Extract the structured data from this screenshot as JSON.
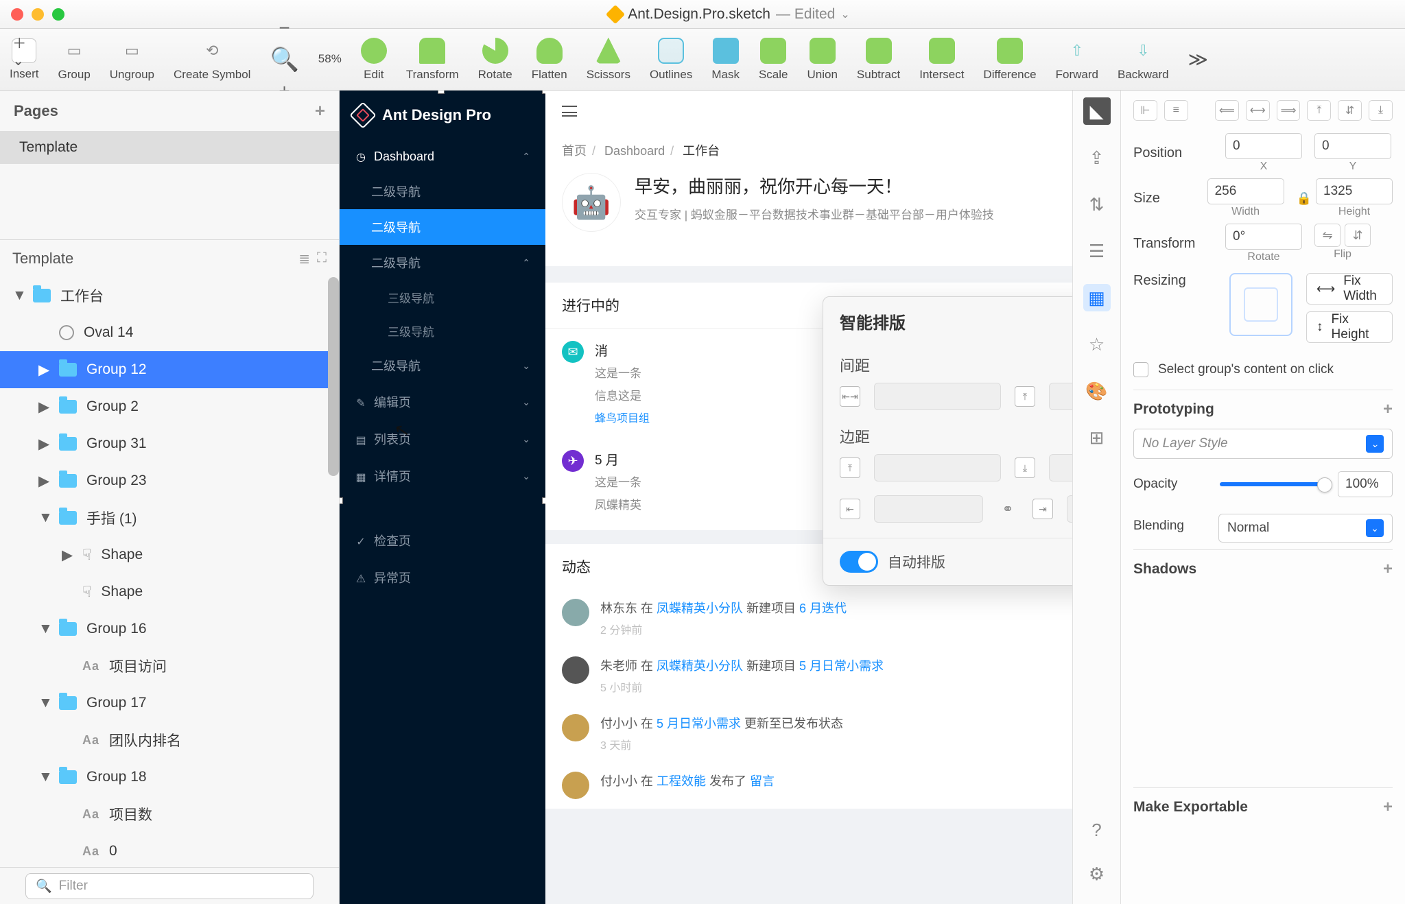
{
  "window": {
    "file": "Ant.Design.Pro.sketch",
    "edited": "— Edited"
  },
  "toolbar": {
    "insert": "Insert",
    "group": "Group",
    "ungroup": "Ungroup",
    "create_symbol": "Create Symbol",
    "zoom": "58%",
    "edit": "Edit",
    "transform": "Transform",
    "rotate": "Rotate",
    "flatten": "Flatten",
    "scissors": "Scissors",
    "outlines": "Outlines",
    "mask": "Mask",
    "scale": "Scale",
    "union": "Union",
    "subtract": "Subtract",
    "intersect": "Intersect",
    "difference": "Difference",
    "forward": "Forward",
    "backward": "Backward"
  },
  "pages": {
    "header": "Pages",
    "item": "Template",
    "subheader": "Template"
  },
  "layers": [
    {
      "kind": "group",
      "depth": 0,
      "open": true,
      "name": "工作台"
    },
    {
      "kind": "oval",
      "depth": 1,
      "name": "Oval 14"
    },
    {
      "kind": "group",
      "depth": 1,
      "name": "Group 12",
      "selected": true
    },
    {
      "kind": "group",
      "depth": 1,
      "name": "Group 2"
    },
    {
      "kind": "group",
      "depth": 1,
      "name": "Group 31"
    },
    {
      "kind": "group",
      "depth": 1,
      "name": "Group 23"
    },
    {
      "kind": "group",
      "depth": 1,
      "open": true,
      "name": "手指 (1)"
    },
    {
      "kind": "shape",
      "depth": 2,
      "name": "Shape",
      "hasTri": true
    },
    {
      "kind": "shape",
      "depth": 2,
      "name": "Shape"
    },
    {
      "kind": "group",
      "depth": 1,
      "open": true,
      "name": "Group 16"
    },
    {
      "kind": "text",
      "depth": 2,
      "name": "项目访问"
    },
    {
      "kind": "group",
      "depth": 1,
      "open": true,
      "name": "Group 17"
    },
    {
      "kind": "text",
      "depth": 2,
      "name": "团队内排名"
    },
    {
      "kind": "group",
      "depth": 1,
      "open": true,
      "name": "Group 18"
    },
    {
      "kind": "text",
      "depth": 2,
      "name": "项目数"
    },
    {
      "kind": "text",
      "depth": 2,
      "name": "0"
    }
  ],
  "filter_placeholder": "Filter",
  "artboard": {
    "brand": "Ant Design Pro",
    "dashboard": "Dashboard",
    "nav2": "二级导航",
    "nav2_active": "二级导航",
    "nav2_expand": "二级导航",
    "nav3a": "三级导航",
    "nav3b": "三级导航",
    "nav2_last": "二级导航",
    "edit": "编辑页",
    "list": "列表页",
    "detail": "详情页",
    "check": "检查页",
    "error": "异常页"
  },
  "content": {
    "crumb_home": "首页",
    "crumb_dashboard": "Dashboard",
    "crumb_current": "工作台",
    "greeting": "早安，曲丽丽，祝你开心每一天！",
    "greeting_sub": "交互专家 | 蚂蚁金服－平台数据技术事业群－基础平台部－用户体验技",
    "panel_title": "进行中的",
    "proj1_title": "消",
    "proj1_d1": "这是一条",
    "proj1_d2": "信息这是",
    "proj1_link": "蜂鸟项目组",
    "proj2_title": "5 月",
    "proj2_desc": "这是一条",
    "proj2_foot": "凤蝶精英",
    "dyn_title": "动态",
    "acts": [
      {
        "user": "林东东",
        "verb": "在",
        "team": "凤蝶精英小分队",
        "action": "新建项目",
        "target": "6 月迭代",
        "time": "2 分钟前",
        "av": "#8aa"
      },
      {
        "user": "朱老师",
        "verb": "在",
        "team": "凤蝶精英小分队",
        "action": "新建项目",
        "target": "5 月日常小需求",
        "time": "5 小时前",
        "av": "#555"
      },
      {
        "user": "付小小",
        "verb": "在",
        "team": "5 月日常小需求",
        "action": "更新至已发布状态",
        "target": "",
        "time": "3 天前",
        "av": "#c8a050"
      },
      {
        "user": "付小小",
        "verb": "在",
        "team": "工程效能",
        "action": "发布了",
        "target": "留言",
        "time": "",
        "av": "#c8a050"
      }
    ]
  },
  "popover": {
    "title": "智能排版",
    "spacing": "间距",
    "margin": "边距",
    "auto": "自动排版"
  },
  "inspector": {
    "position": "Position",
    "x": "0",
    "y": "0",
    "xl": "X",
    "yl": "Y",
    "size": "Size",
    "w": "256",
    "h": "1325",
    "wl": "Width",
    "hl": "Height",
    "transform": "Transform",
    "rot": "0°",
    "rotl": "Rotate",
    "flipl": "Flip",
    "resizing": "Resizing",
    "fix_width": "Fix Width",
    "fix_height": "Fix Height",
    "select_group": "Select group's content on click",
    "prototyping": "Prototyping",
    "no_layer_style": "No Layer Style",
    "opacity": "Opacity",
    "opacity_val": "100%",
    "blending": "Blending",
    "blend_val": "Normal",
    "shadows": "Shadows",
    "exportable": "Make Exportable"
  }
}
